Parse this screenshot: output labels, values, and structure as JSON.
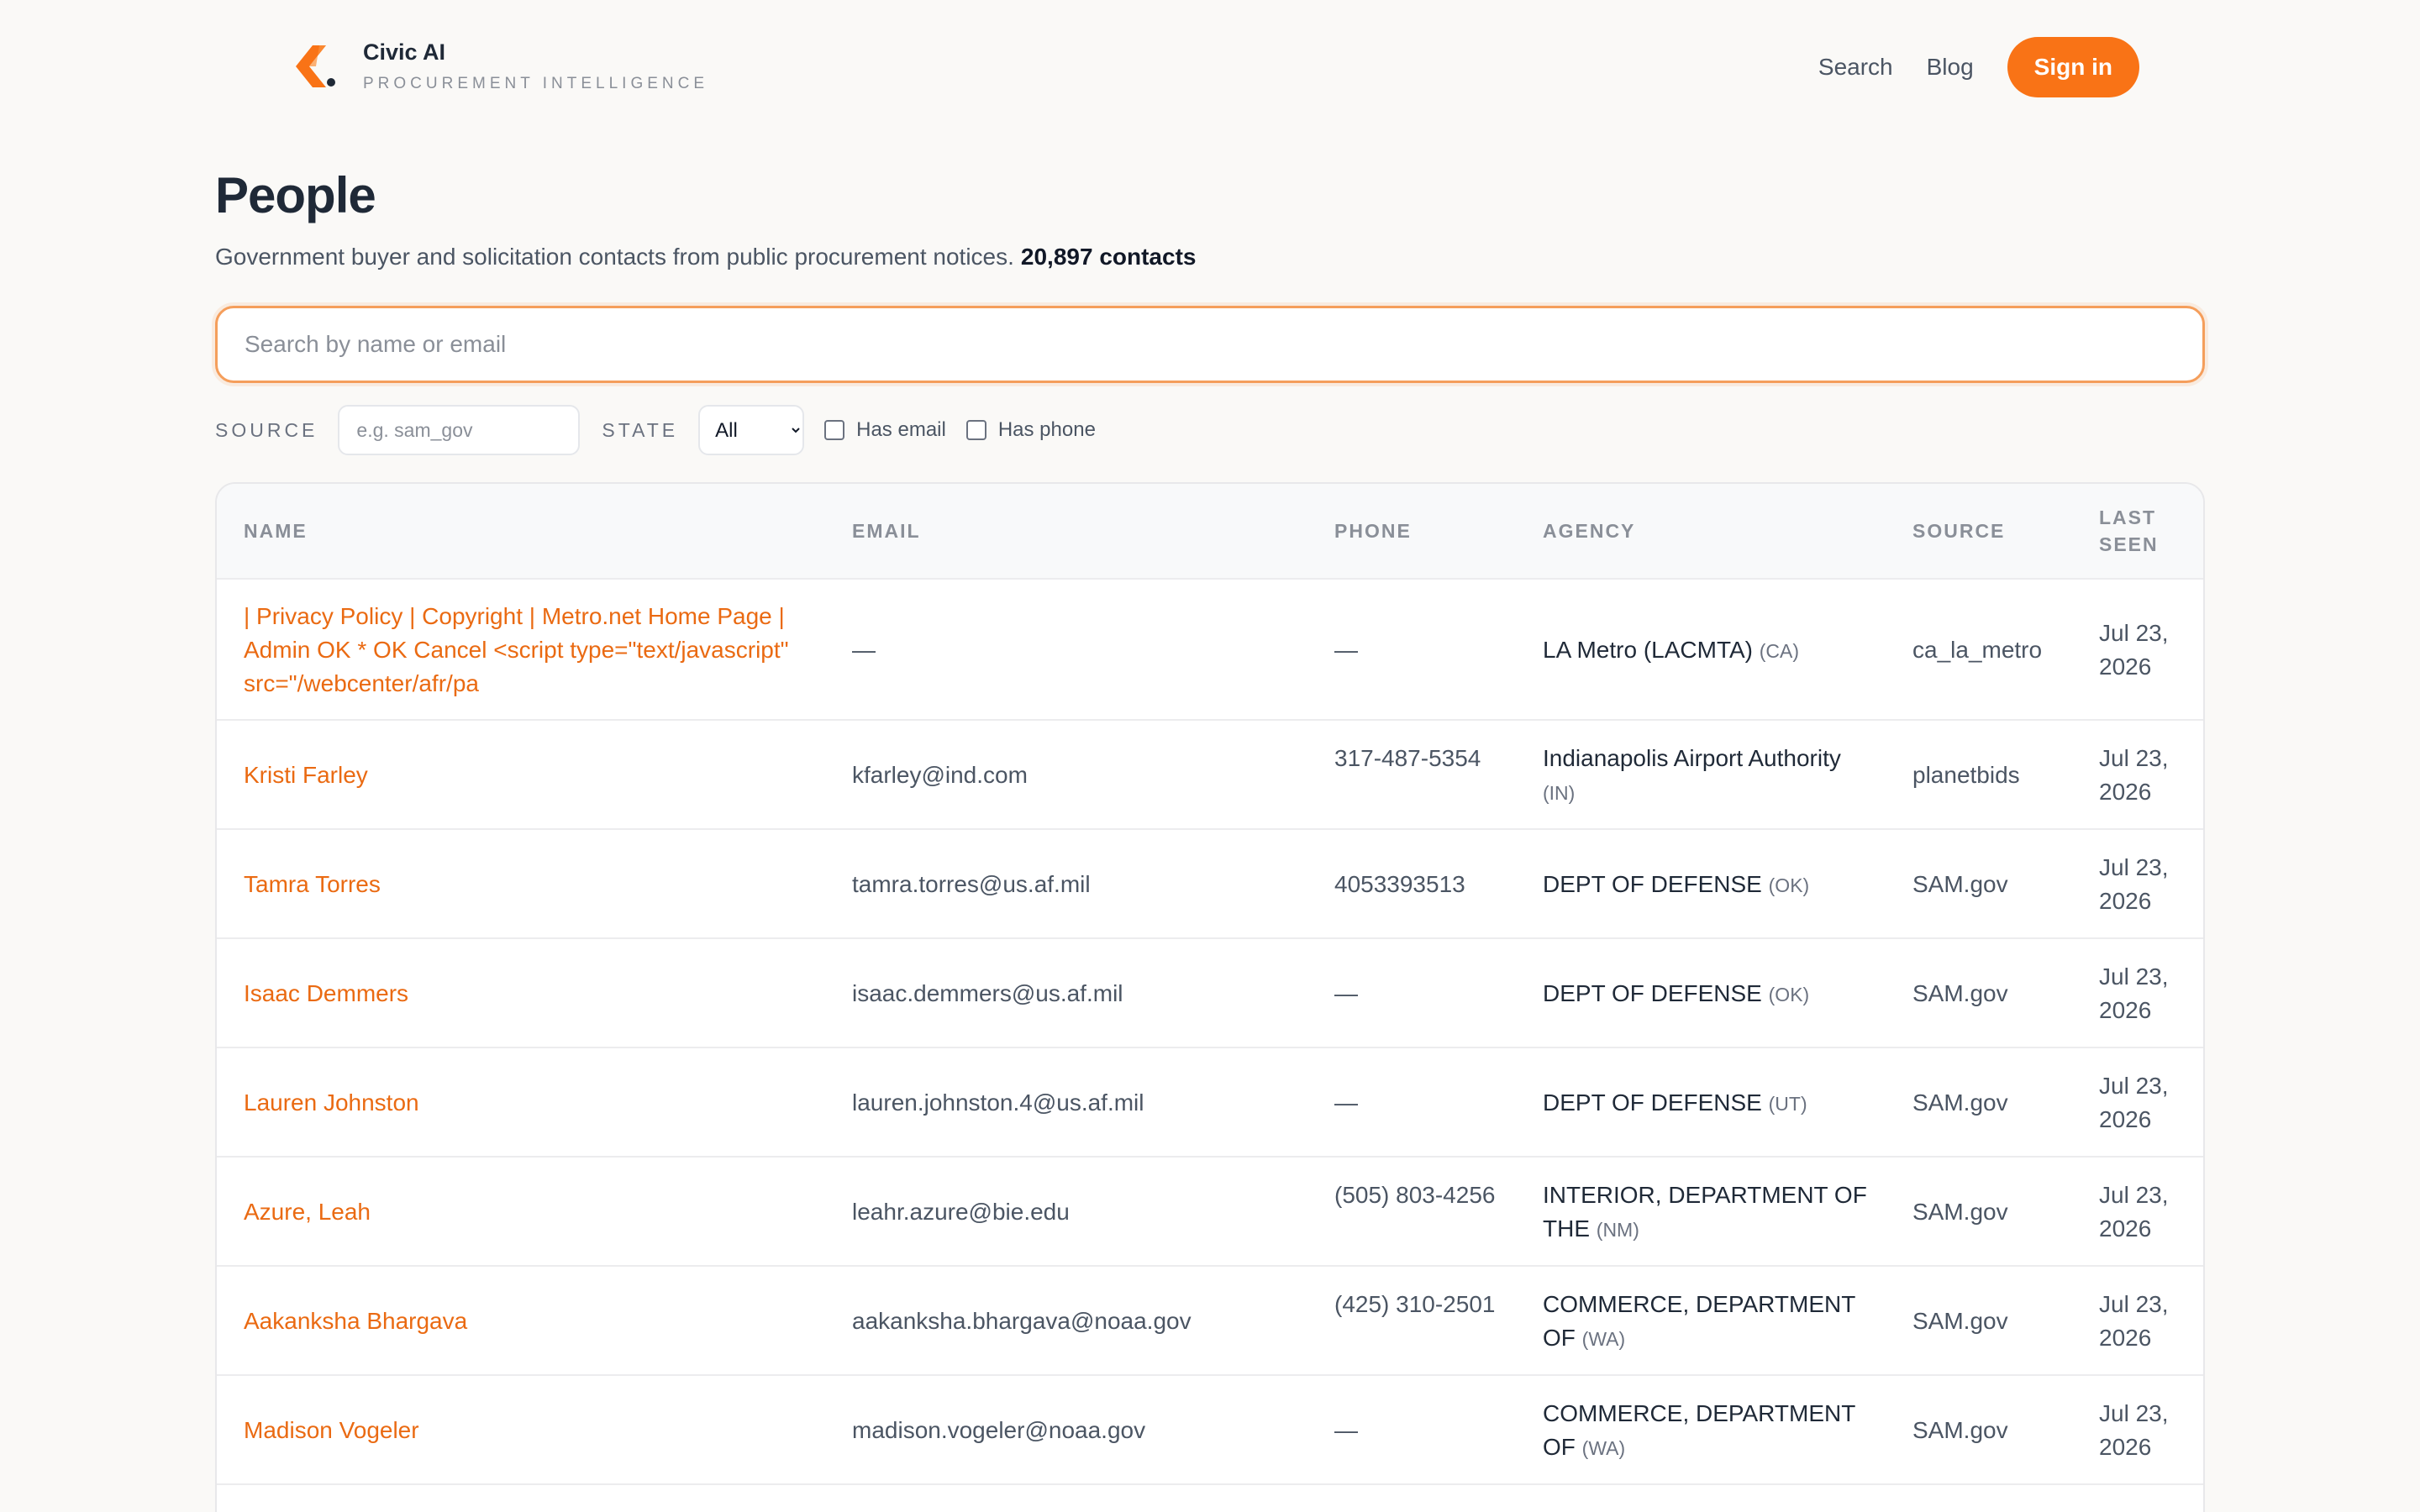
{
  "brand": {
    "name": "Civic AI",
    "tagline": "PROCUREMENT INTELLIGENCE",
    "accent": "#f97316"
  },
  "nav": {
    "search": "Search",
    "blog": "Blog",
    "sign_in": "Sign in"
  },
  "page": {
    "title": "People",
    "subtitle": "Government buyer and solicitation contacts from public procurement notices.",
    "count": "20,897 contacts"
  },
  "search": {
    "placeholder": "Search by name or email"
  },
  "filters": {
    "source_label": "SOURCE",
    "source_placeholder": "e.g. sam_gov",
    "state_label": "STATE",
    "state_value": "All",
    "has_email": "Has email",
    "has_phone": "Has phone"
  },
  "table": {
    "columns": {
      "name": "NAME",
      "email": "EMAIL",
      "phone": "PHONE",
      "agency": "AGENCY",
      "source": "SOURCE",
      "last_seen": "LAST SEEN"
    },
    "rows": [
      {
        "name": "| Privacy Policy | Copyright | Metro.net Home Page | Admin OK * OK Cancel <script type=\"text/javascript\" src=\"/webcenter/afr/pa",
        "email": "—",
        "phone": "—",
        "agency": "LA Metro (LACMTA)",
        "state": "(CA)",
        "source": "ca_la_metro",
        "last_seen": "Jul 23, 2026"
      },
      {
        "name": "Kristi Farley",
        "email": "kfarley@ind.com",
        "phone": "317-487-5354",
        "agency": "Indianapolis Airport Authority",
        "state": "(IN)",
        "source": "planetbids",
        "last_seen": "Jul 23, 2026"
      },
      {
        "name": "Tamra Torres",
        "email": "tamra.torres@us.af.mil",
        "phone": "4053393513",
        "agency": "DEPT OF DEFENSE",
        "state": "(OK)",
        "source": "SAM.gov",
        "last_seen": "Jul 23, 2026"
      },
      {
        "name": "Isaac Demmers",
        "email": "isaac.demmers@us.af.mil",
        "phone": "—",
        "agency": "DEPT OF DEFENSE",
        "state": "(OK)",
        "source": "SAM.gov",
        "last_seen": "Jul 23, 2026"
      },
      {
        "name": "Lauren Johnston",
        "email": "lauren.johnston.4@us.af.mil",
        "phone": "—",
        "agency": "DEPT OF DEFENSE",
        "state": "(UT)",
        "source": "SAM.gov",
        "last_seen": "Jul 23, 2026"
      },
      {
        "name": "Azure, Leah",
        "email": "leahr.azure@bie.edu",
        "phone": "(505) 803-4256",
        "agency": "INTERIOR, DEPARTMENT OF THE",
        "state": "(NM)",
        "source": "SAM.gov",
        "last_seen": "Jul 23, 2026"
      },
      {
        "name": "Aakanksha Bhargava",
        "email": "aakanksha.bhargava@noaa.gov",
        "phone": "(425) 310-2501",
        "agency": "COMMERCE, DEPARTMENT OF",
        "state": "(WA)",
        "source": "SAM.gov",
        "last_seen": "Jul 23, 2026"
      },
      {
        "name": "Madison Vogeler",
        "email": "madison.vogeler@noaa.gov",
        "phone": "—",
        "agency": "COMMERCE, DEPARTMENT OF",
        "state": "(WA)",
        "source": "SAM.gov",
        "last_seen": "Jul 23, 2026"
      }
    ]
  }
}
